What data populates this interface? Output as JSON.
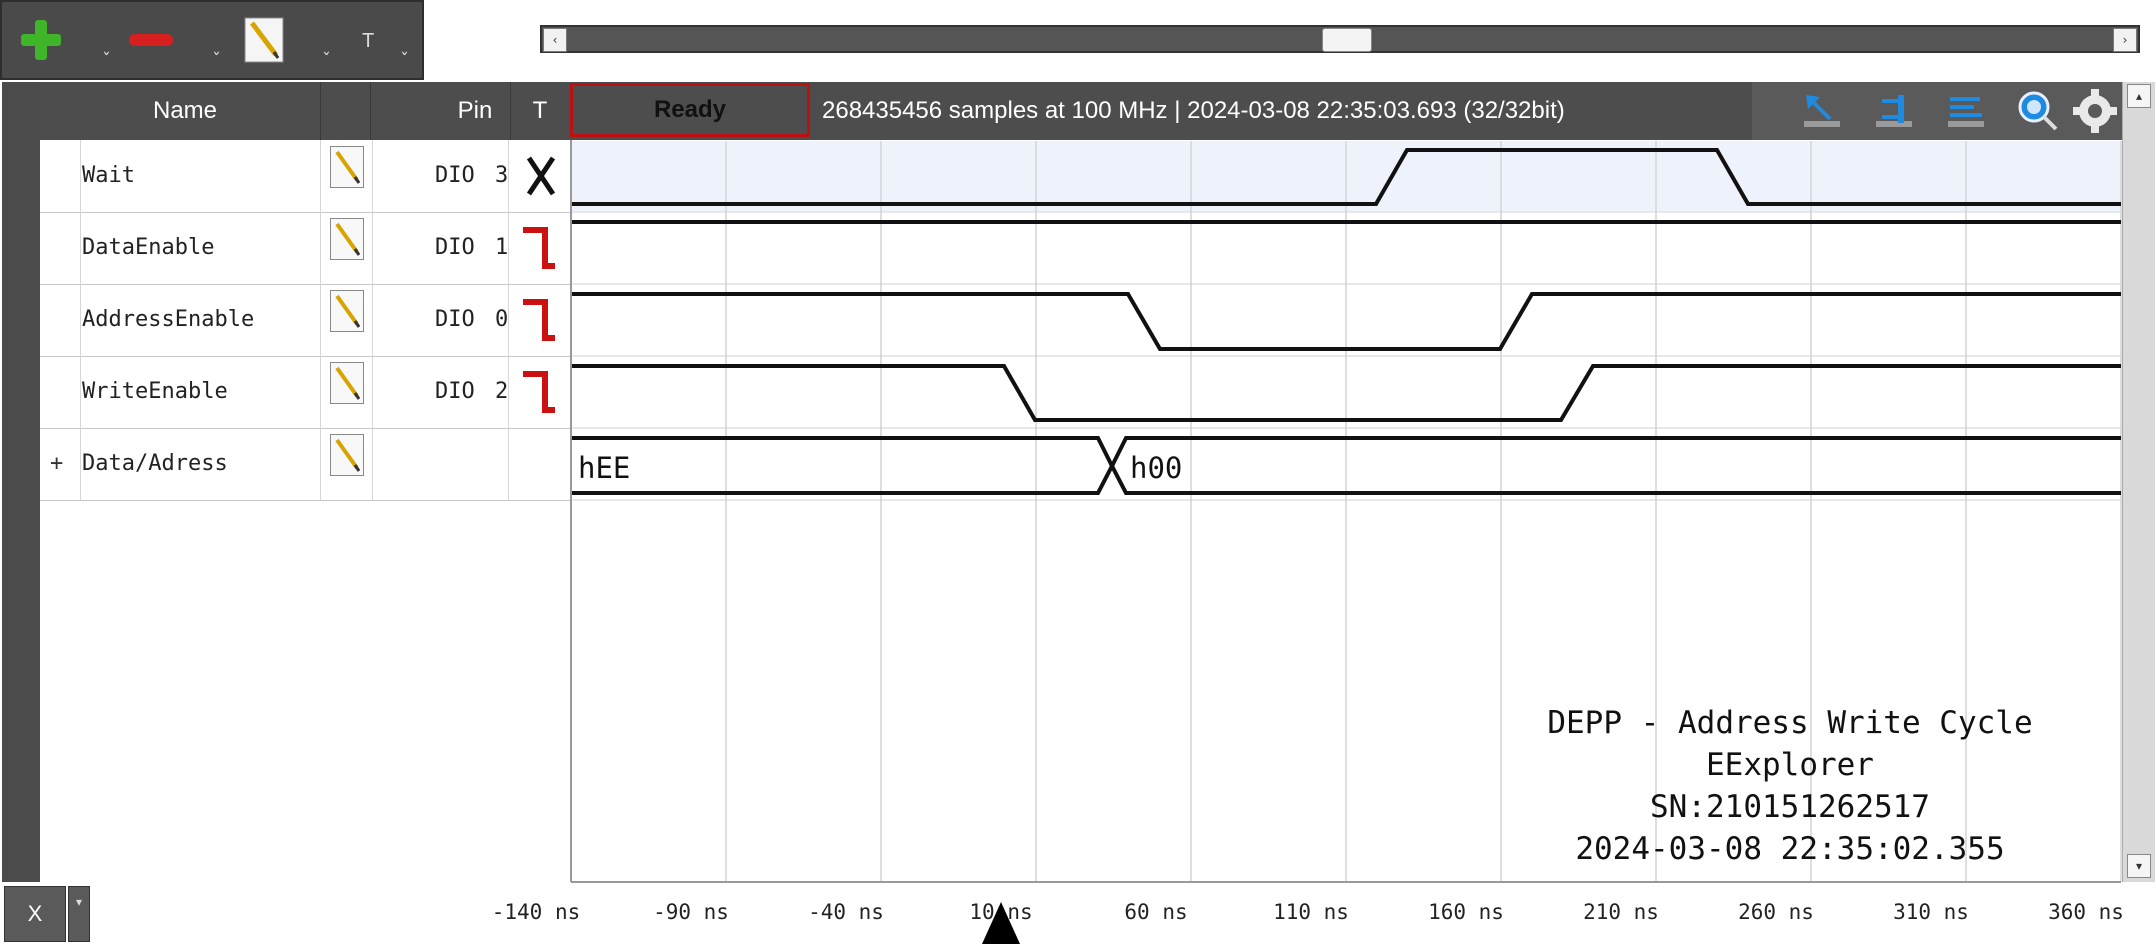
{
  "toolbar": {
    "add_icon": "plus-icon",
    "remove_icon": "minus-icon",
    "edit_icon": "pencil-icon",
    "text_label": "T",
    "dropdown_caret": "ˇ"
  },
  "header": {
    "name_label": "Name",
    "pin_label": "Pin",
    "trigger_label": "T",
    "status": "Ready",
    "info": "268435456 samples at 100 MHz | 2024-03-08 22:35:03.693 (32/32bit)"
  },
  "tools": [
    "cursor-arrow-icon",
    "cursor-bar-icon",
    "ruler-icon",
    "zoom-icon",
    "gear-icon"
  ],
  "signals": [
    {
      "name": "Wait",
      "pin": "DIO",
      "pin_num": "3",
      "trigger": "either-edge",
      "expandable": false
    },
    {
      "name": "DataEnable",
      "pin": "DIO",
      "pin_num": "1",
      "trigger": "falling-edge",
      "expandable": false
    },
    {
      "name": "AddressEnable",
      "pin": "DIO",
      "pin_num": "0",
      "trigger": "falling-edge",
      "expandable": false
    },
    {
      "name": "WriteEnable",
      "pin": "DIO",
      "pin_num": "2",
      "trigger": "falling-edge",
      "expandable": false
    },
    {
      "name": "Data/Adress",
      "pin": "",
      "pin_num": "",
      "trigger": "none",
      "expandable": true,
      "expand_symbol": "+"
    }
  ],
  "bus_values": [
    "hEE",
    "h00"
  ],
  "timeline": {
    "unit": "ns",
    "ticks": [
      "-140 ns",
      "-90 ns",
      "-40 ns",
      "10 ns",
      "60 ns",
      "110 ns",
      "160 ns",
      "210 ns",
      "260 ns",
      "310 ns",
      "360 ns"
    ],
    "x_button": "X",
    "dropdown_caret": "▾"
  },
  "annotation": {
    "line1": "DEPP - Address Write Cycle",
    "line2": "EExplorer",
    "line3": "SN:210151262517",
    "line4": "2024-03-08 22:35:02.355"
  },
  "scroll_arrows": {
    "left": "‹",
    "right": "›",
    "up": "▴",
    "down": "▾"
  },
  "colors": {
    "wave": "#111111",
    "trigger_edge": "#cc1111",
    "highlight_row": "#eef2fb",
    "header": "#4d4d4d"
  }
}
